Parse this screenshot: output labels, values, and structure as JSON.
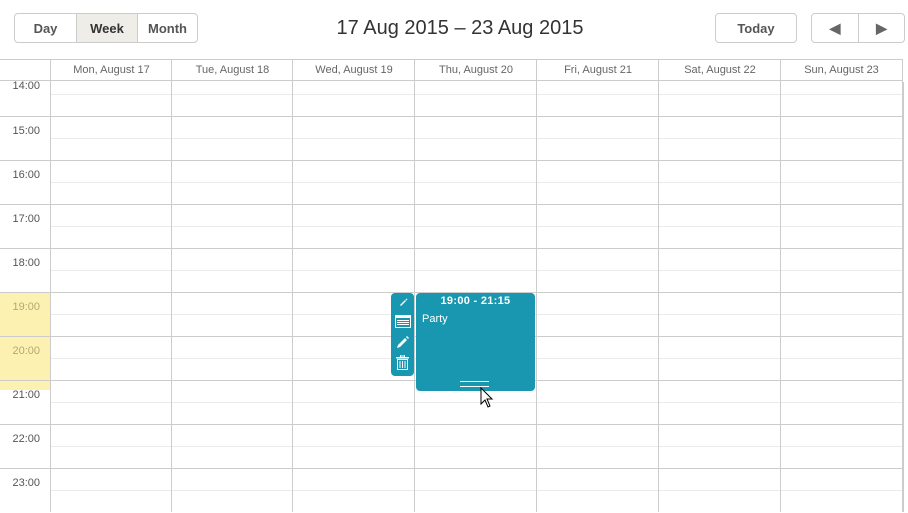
{
  "toolbar": {
    "views": [
      {
        "label": "Day",
        "active": false
      },
      {
        "label": "Week",
        "active": true
      },
      {
        "label": "Month",
        "active": false
      }
    ],
    "title": "17 Aug 2015 – 23 Aug 2015",
    "today_label": "Today",
    "prev_icon": "◀",
    "next_icon": "▶"
  },
  "days": [
    {
      "label": "Mon, August 17"
    },
    {
      "label": "Tue, August 18"
    },
    {
      "label": "Wed, August 19"
    },
    {
      "label": "Thu, August 20"
    },
    {
      "label": "Fri, August 21"
    },
    {
      "label": "Sat, August 22"
    },
    {
      "label": "Sun, August 23"
    }
  ],
  "hours": [
    "14:00",
    "15:00",
    "16:00",
    "17:00",
    "18:00",
    "19:00",
    "20:00",
    "21:00",
    "22:00",
    "23:00"
  ],
  "highlighted_hours": [
    "19:00",
    "20:00"
  ],
  "event": {
    "time": "19:00 - 21:15",
    "title": "Party",
    "day": "Thu, August 20",
    "color": "#1a97b0"
  },
  "event_tools": [
    "pencil-icon",
    "details-icon",
    "edit-icon",
    "delete-icon"
  ],
  "colors": {
    "event": "#1a97b0",
    "highlight": "#fcf1b0",
    "active_view": "#efede8"
  }
}
